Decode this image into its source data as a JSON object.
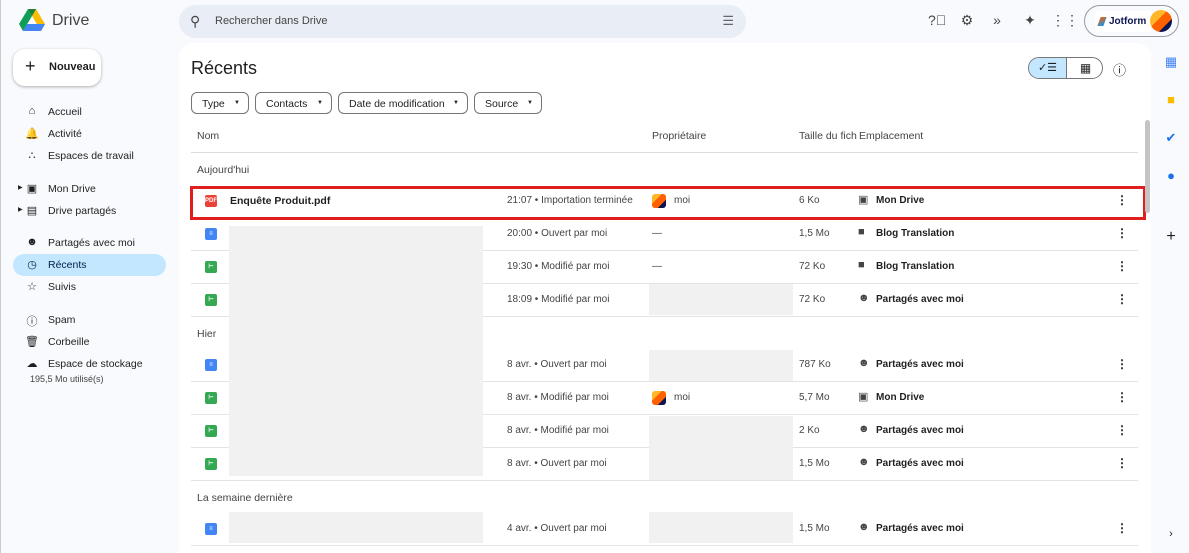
{
  "app": {
    "name": "Drive",
    "search_placeholder": "Rechercher dans Drive",
    "jotform": "Jotform"
  },
  "new_button": "Nouveau",
  "sidebar": {
    "items": [
      {
        "label": "Accueil",
        "icon": "home-icon"
      },
      {
        "label": "Activité",
        "icon": "bell-icon"
      },
      {
        "label": "Espaces de travail",
        "icon": "workspaces-icon"
      },
      {
        "label": "Mon Drive",
        "icon": "my-drive-icon"
      },
      {
        "label": "Drive partagés",
        "icon": "shared-drives-icon"
      },
      {
        "label": "Partagés avec moi",
        "icon": "people-icon"
      },
      {
        "label": "Récents",
        "icon": "clock-icon",
        "active": true
      },
      {
        "label": "Suivis",
        "icon": "star-icon"
      },
      {
        "label": "Spam",
        "icon": "spam-icon"
      },
      {
        "label": "Corbeille",
        "icon": "trash-icon"
      },
      {
        "label": "Espace de stockage",
        "icon": "cloud-icon"
      }
    ],
    "storage_usage": "195,5 Mo utilisé(s)"
  },
  "main": {
    "title": "Récents",
    "filters": [
      "Type",
      "Contacts",
      "Date de modification",
      "Source"
    ],
    "columns": {
      "name": "Nom",
      "owner": "Propriétaire",
      "size": "Taille du fich",
      "location": "Emplacement"
    },
    "groups": [
      "Aujourd'hui",
      "Hier",
      "La semaine dernière"
    ],
    "rows": [
      {
        "type": "pdf",
        "name": "Enquête Produit.pdf",
        "activity": "21:07 • Importation terminée",
        "owner": "moi",
        "size": "6 Ko",
        "location": "Mon Drive"
      },
      {
        "type": "doc",
        "name": "",
        "activity": "20:00 • Ouvert par moi",
        "owner": "—",
        "size": "1,5 Mo",
        "location": "Blog Translation"
      },
      {
        "type": "sheet",
        "name": "",
        "activity": "19:30 • Modifié par moi",
        "owner": "—",
        "size": "72 Ko",
        "location": "Blog Translation"
      },
      {
        "type": "sheet",
        "name": "",
        "activity": "18:09 • Modifié par moi",
        "owner": "",
        "size": "72 Ko",
        "location": "Partagés avec moi"
      },
      {
        "type": "doc",
        "name": "",
        "activity": "8 avr. • Ouvert par moi",
        "owner": "",
        "size": "787 Ko",
        "location": "Partagés avec moi"
      },
      {
        "type": "sheet",
        "name": "",
        "activity": "8 avr. • Modifié par moi",
        "owner": "moi",
        "size": "5,7 Mo",
        "location": "Mon Drive"
      },
      {
        "type": "sheet",
        "name": "",
        "activity": "8 avr. • Modifié par moi",
        "owner": "",
        "size": "2 Ko",
        "location": "Partagés avec moi"
      },
      {
        "type": "sheet",
        "name": "",
        "activity": "8 avr. • Ouvert par moi",
        "owner": "",
        "size": "1,5 Mo",
        "location": "Partagés avec moi"
      },
      {
        "type": "doc",
        "name": "",
        "activity": "4 avr. • Ouvert par moi",
        "owner": "",
        "size": "1,5 Mo",
        "location": "Partagés avec moi"
      }
    ]
  },
  "colors": {
    "accent": "#c2e7ff",
    "highlight": "#e01e1e",
    "pdf": "#ea4335",
    "doc": "#4285f4",
    "sheet": "#34a853"
  }
}
